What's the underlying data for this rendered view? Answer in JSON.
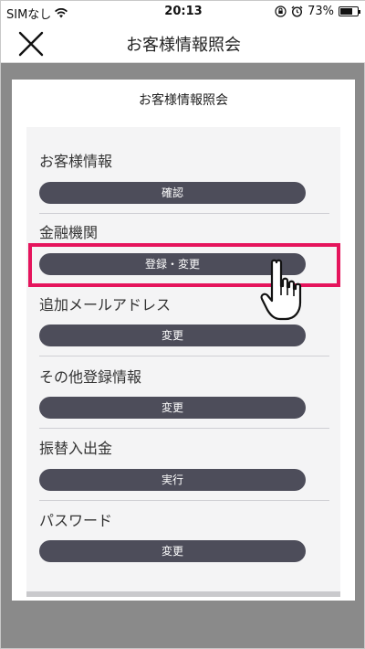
{
  "status_bar": {
    "carrier": "SIMなし",
    "time": "20:13",
    "battery": "73%",
    "battery_level": 0.73
  },
  "nav": {
    "title": "お客様情報照会",
    "close_icon": "close-icon"
  },
  "card": {
    "title": "お客様情報照会",
    "sections": [
      {
        "label": "お客様情報",
        "button": "確認"
      },
      {
        "label": "金融機関",
        "button": "登録・変更"
      },
      {
        "label": "追加メールアドレス",
        "button": "変更"
      },
      {
        "label": "その他登録情報",
        "button": "変更"
      },
      {
        "label": "振替入出金",
        "button": "実行"
      },
      {
        "label": "パスワード",
        "button": "変更"
      }
    ]
  },
  "colors": {
    "highlight": "#e5145c",
    "button": "#4d4d5a",
    "overlay": "#8a8a8a"
  }
}
